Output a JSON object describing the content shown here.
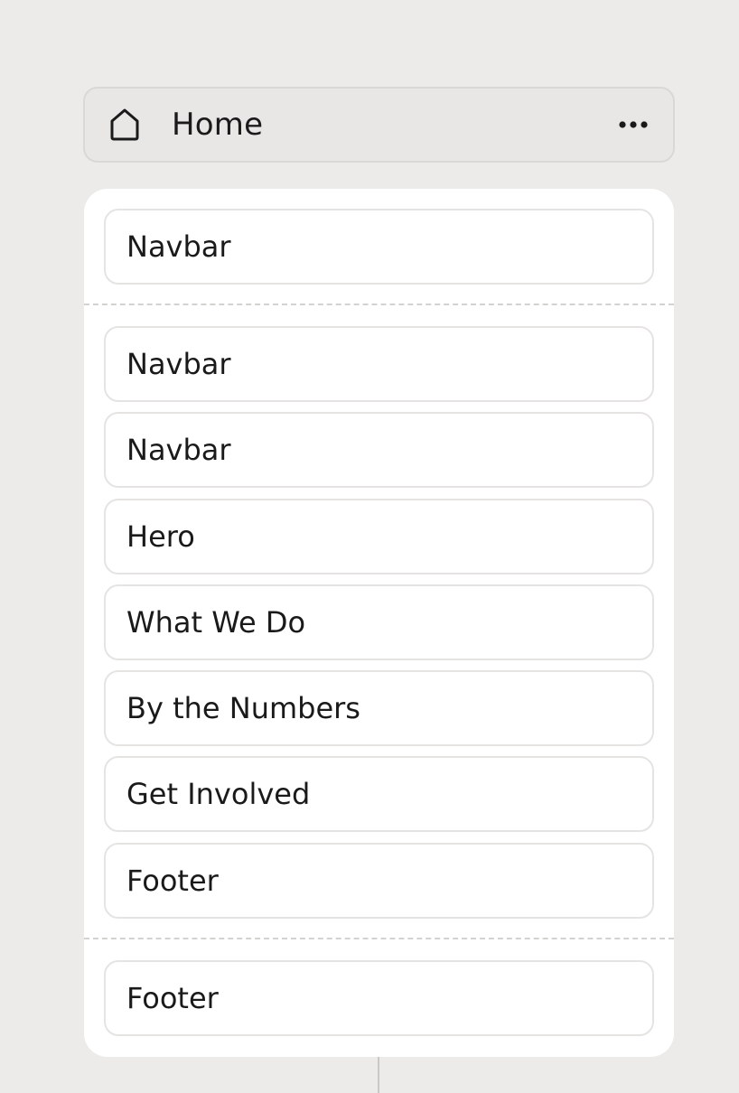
{
  "page": {
    "title": "Home",
    "icon": "home-icon",
    "menu_icon": "more-horizontal-icon"
  },
  "sections": {
    "header_group": [
      {
        "label": "Navbar"
      }
    ],
    "body_group": [
      {
        "label": "Navbar"
      },
      {
        "label": "Navbar"
      },
      {
        "label": "Hero"
      },
      {
        "label": "What We Do"
      },
      {
        "label": "By the Numbers"
      },
      {
        "label": "Get Involved"
      },
      {
        "label": "Footer"
      }
    ],
    "footer_group": [
      {
        "label": "Footer"
      }
    ]
  },
  "colors": {
    "background": "#ecebe9",
    "panel": "#ffffff",
    "border": "#e5e4e2",
    "text": "#1a1a1a"
  }
}
